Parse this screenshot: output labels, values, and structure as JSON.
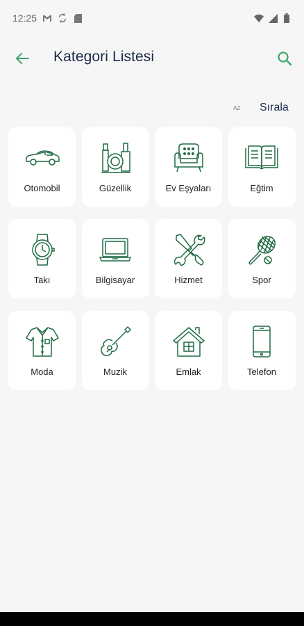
{
  "status_bar": {
    "time": "12:25",
    "icons_left": [
      "gmail-icon",
      "sync-icon",
      "sd-card-icon"
    ],
    "icons_right": [
      "wifi-icon",
      "signal-icon",
      "battery-icon"
    ]
  },
  "header": {
    "title": "Kategori Listesi",
    "back_icon": "arrow-left-icon",
    "search_icon": "search-icon"
  },
  "sort": {
    "icon_text": "AZ",
    "label": "Sırala"
  },
  "categories": [
    {
      "label": "Otomobil",
      "icon": "car-icon"
    },
    {
      "label": "Güzellik",
      "icon": "beauty-icon"
    },
    {
      "label": "Ev Eşyaları",
      "icon": "sofa-icon"
    },
    {
      "label": "Eğtim",
      "icon": "book-icon"
    },
    {
      "label": "Takı",
      "icon": "watch-icon"
    },
    {
      "label": "Bilgisayar",
      "icon": "laptop-icon"
    },
    {
      "label": "Hizmet",
      "icon": "tools-icon"
    },
    {
      "label": "Spor",
      "icon": "tennis-icon"
    },
    {
      "label": "Moda",
      "icon": "shirt-icon"
    },
    {
      "label": "Muzik",
      "icon": "guitar-icon"
    },
    {
      "label": "Emlak",
      "icon": "house-icon"
    },
    {
      "label": "Telefon",
      "icon": "phone-icon"
    }
  ],
  "colors": {
    "accent": "#2e8b57",
    "icon_stroke": "#1f6b43",
    "title": "#1b2a4a",
    "background": "#f6f6f6",
    "card": "#ffffff"
  }
}
